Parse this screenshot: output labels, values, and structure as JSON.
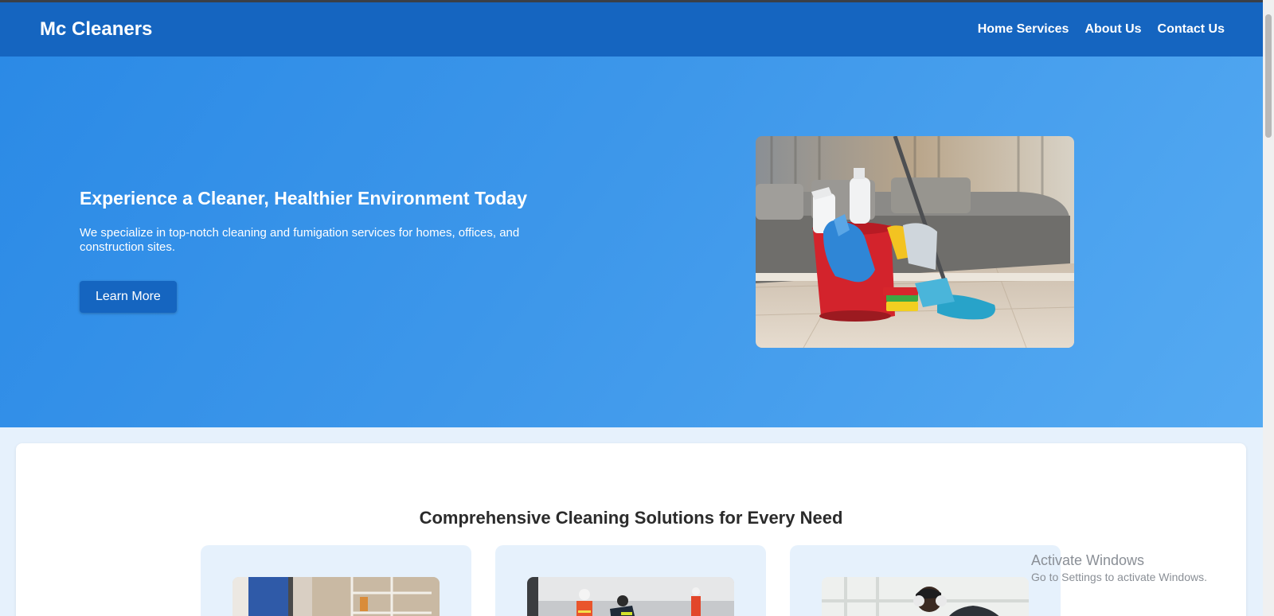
{
  "brand": "Mc Cleaners",
  "nav": [
    {
      "label": "Home Services"
    },
    {
      "label": "About Us"
    },
    {
      "label": "Contact Us"
    }
  ],
  "hero": {
    "title": "Experience a Cleaner, Healthier Environment Today",
    "subtitle": "We specialize in top-notch cleaning and fumigation services for homes, offices, and construction sites.",
    "button_label": "Learn More"
  },
  "services": {
    "title": "Comprehensive Cleaning Solutions for Every Need"
  },
  "watermark": {
    "line1": "Activate Windows",
    "line2": "Go to Settings to activate Windows."
  },
  "colors": {
    "nav_bg": "#1565c0",
    "hero_gradient_start": "#2b8ae6",
    "hero_gradient_end": "#55aaf2",
    "page_bg": "#e6f1fc",
    "button_bg": "#1565c0"
  }
}
